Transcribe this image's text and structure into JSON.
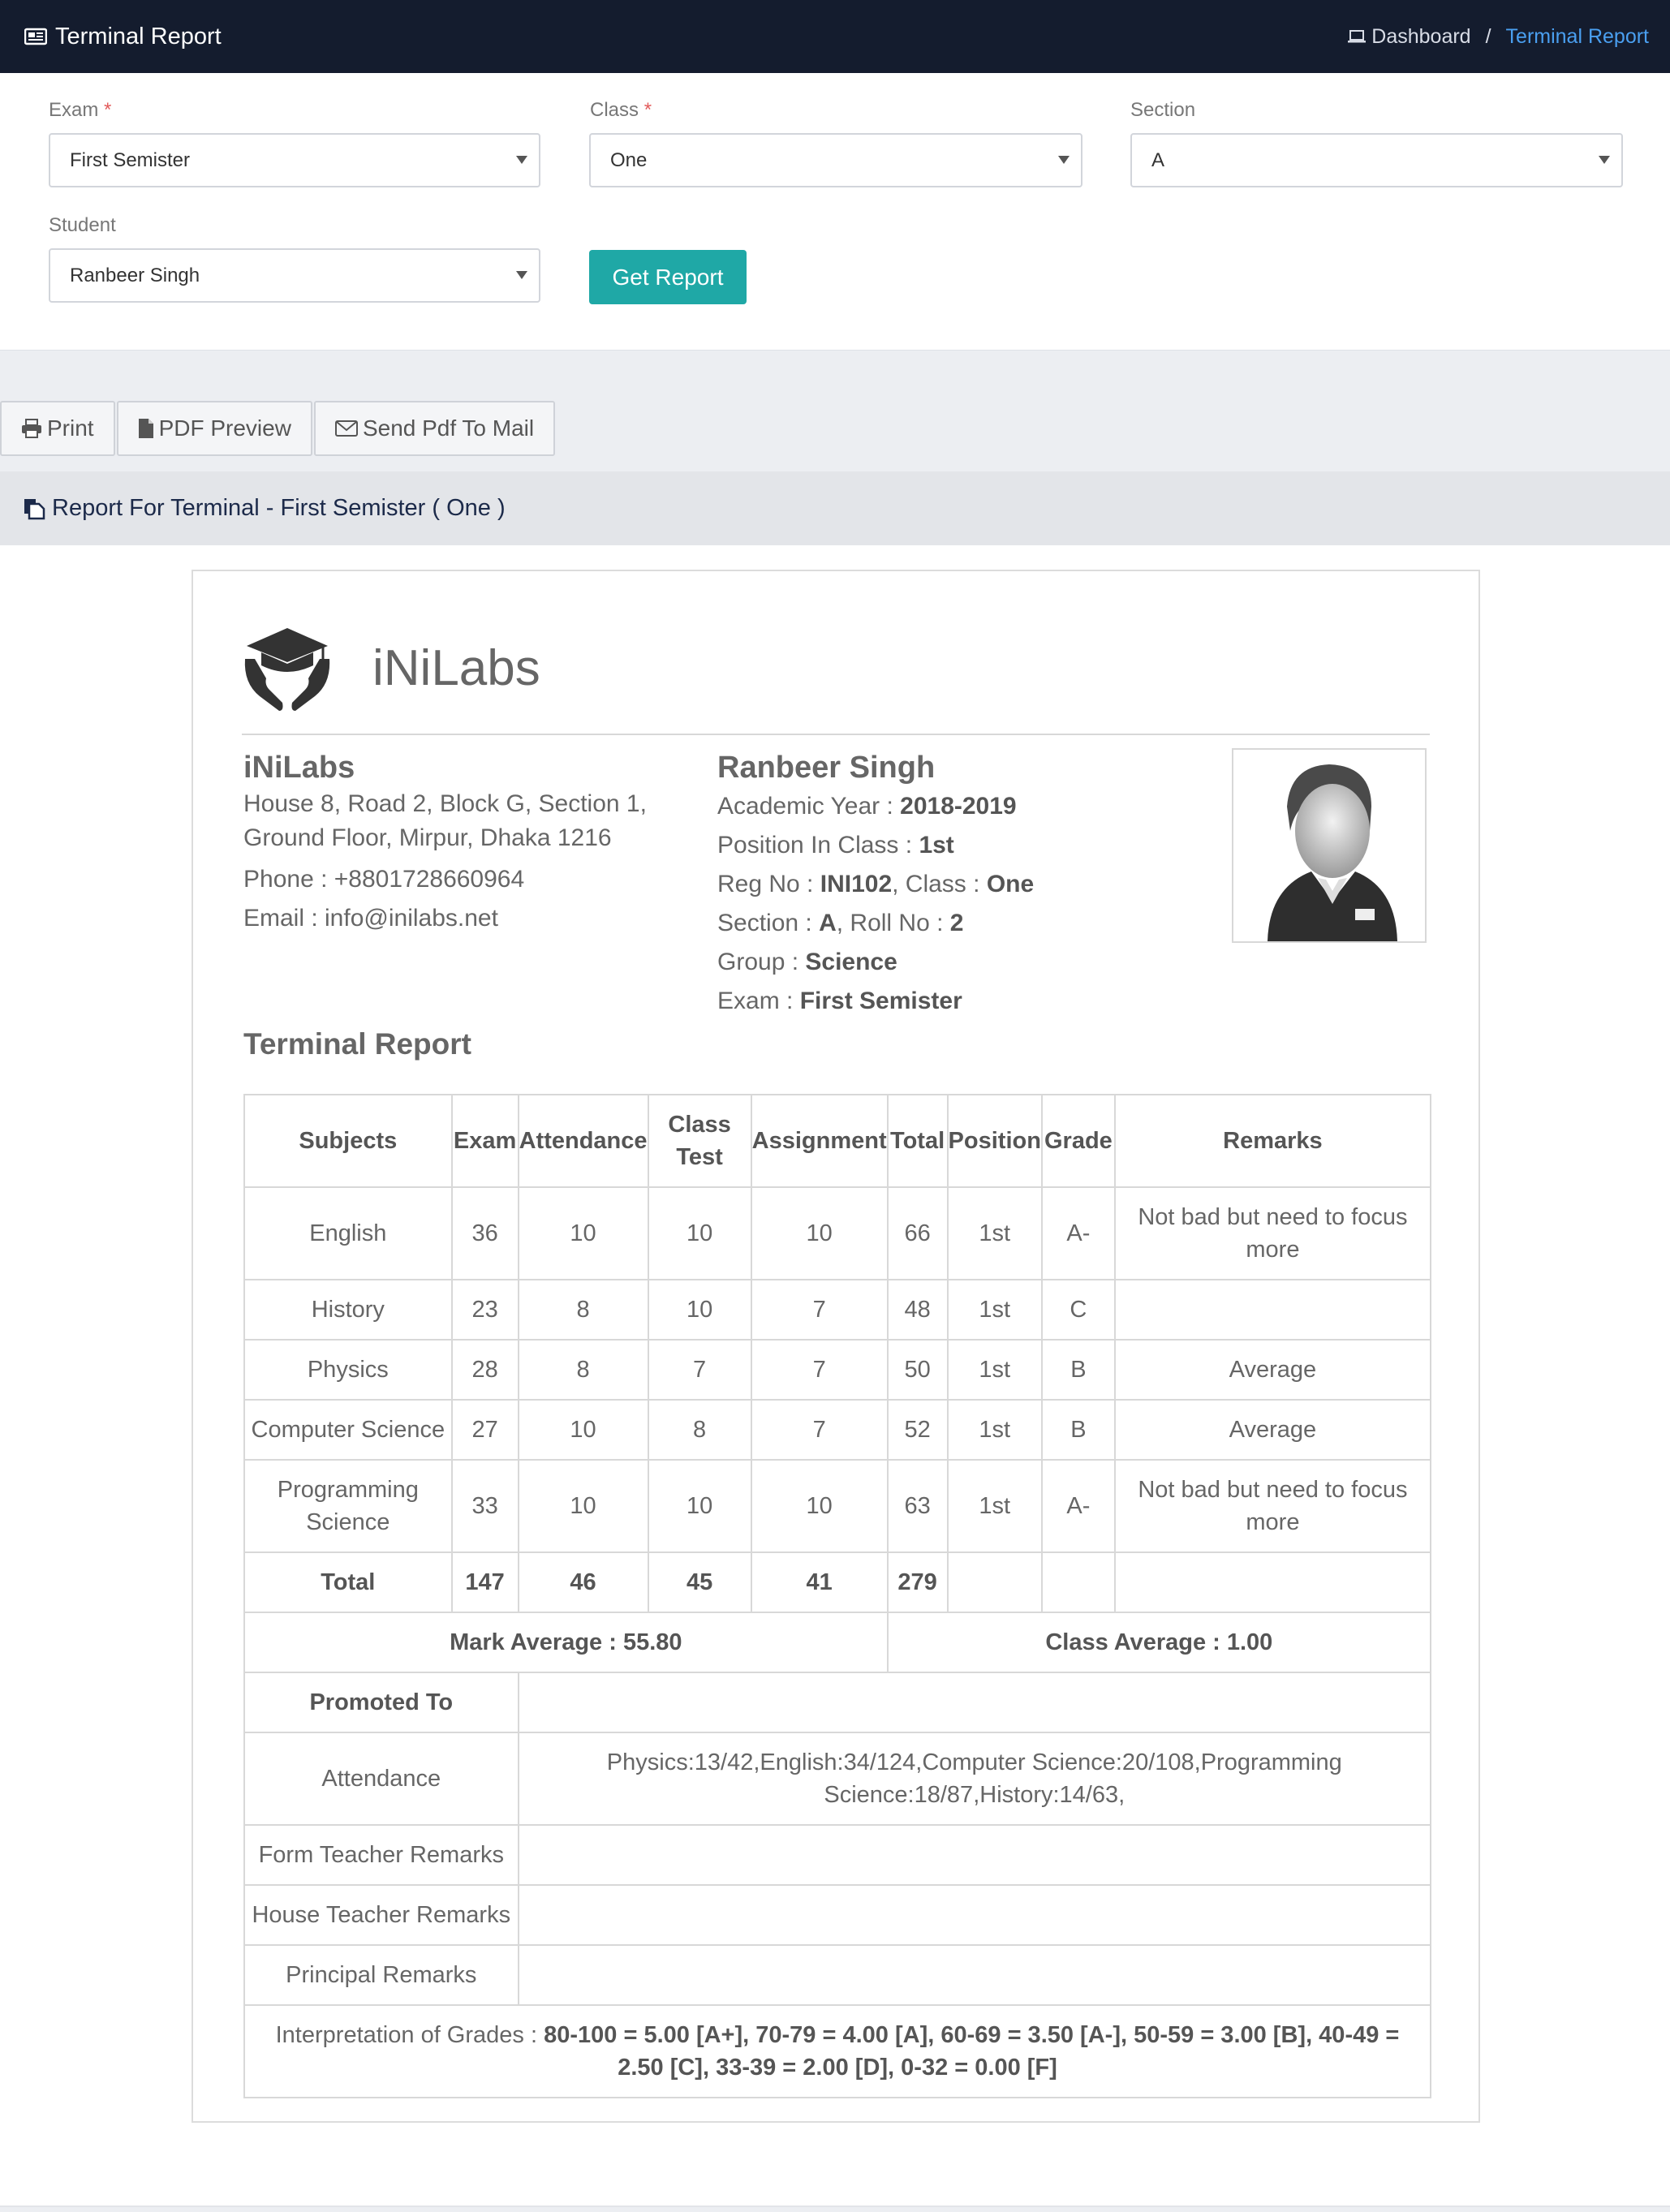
{
  "topbar": {
    "title": "Terminal Report",
    "breadcrumb_home": "Dashboard",
    "breadcrumb_sep": "/",
    "breadcrumb_current": "Terminal Report"
  },
  "filters": {
    "exam_label": "Exam",
    "exam_value": "First Semister",
    "class_label": "Class",
    "class_value": "One",
    "section_label": "Section",
    "section_value": "A",
    "student_label": "Student",
    "student_value": "Ranbeer Singh",
    "required_mark": "*",
    "get_report": "Get Report"
  },
  "actions": {
    "print": "Print",
    "pdf_preview": "PDF Preview",
    "send_mail": "Send Pdf To Mail"
  },
  "report_header": "Report For Terminal - First Semister ( One )",
  "sheet": {
    "brand": "iNiLabs",
    "school": {
      "name": "iNiLabs",
      "address1": "House 8, Road 2, Block G, Section 1,",
      "address2": "Ground Floor, Mirpur, Dhaka 1216",
      "phone": "Phone : +8801728660964",
      "email": "Email : info@inilabs.net"
    },
    "student": {
      "name": "Ranbeer Singh",
      "academic_year_label": "Academic Year : ",
      "academic_year": "2018-2019",
      "position_label": "Position In Class : ",
      "position": "1st",
      "reg_label": "Reg No : ",
      "reg": "INI102",
      "class_label": ", Class : ",
      "class": "One",
      "section_label": "Section : ",
      "section": "A",
      "roll_label": ", Roll No : ",
      "roll": "2",
      "group_label": "Group : ",
      "group": "Science",
      "exam_label": "Exam : ",
      "exam": "First Semister"
    },
    "section_title": "Terminal Report",
    "headers": [
      "Subjects",
      "Exam",
      "Attendance",
      "Class Test",
      "Assignment",
      "Total",
      "Position",
      "Grade",
      "Remarks"
    ],
    "rows": [
      [
        "English",
        "36",
        "10",
        "10",
        "10",
        "66",
        "1st",
        "A-",
        "Not bad but need to focus more"
      ],
      [
        "History",
        "23",
        "8",
        "10",
        "7",
        "48",
        "1st",
        "C",
        ""
      ],
      [
        "Physics",
        "28",
        "8",
        "7",
        "7",
        "50",
        "1st",
        "B",
        "Average"
      ],
      [
        "Computer Science",
        "27",
        "10",
        "8",
        "7",
        "52",
        "1st",
        "B",
        "Average"
      ],
      [
        "Programming Science",
        "33",
        "10",
        "10",
        "10",
        "63",
        "1st",
        "A-",
        "Not bad but need to focus more"
      ]
    ],
    "total_row": [
      "Total",
      "147",
      "46",
      "45",
      "41",
      "279"
    ],
    "mark_average": "Mark Average : 55.80",
    "class_average": "Class Average : 1.00",
    "promoted_to_label": "Promoted To",
    "promoted_to_value": "",
    "attendance_label": "Attendance",
    "attendance_value": "Physics:13/42,English:34/124,Computer Science:20/108,Programming Science:18/87,History:14/63,",
    "form_teacher_label": "Form Teacher Remarks",
    "house_teacher_label": "House Teacher Remarks",
    "principal_label": "Principal Remarks",
    "interp_label": "Interpretation of Grades : ",
    "interp_value": "80-100 = 5.00 [A+], 70-79 = 4.00 [A], 60-69 = 3.50 [A-], 50-59 = 3.00 [B], 40-49 = 2.50 [C], 33-39 = 2.00 [D], 0-32 = 0.00 [F]"
  }
}
